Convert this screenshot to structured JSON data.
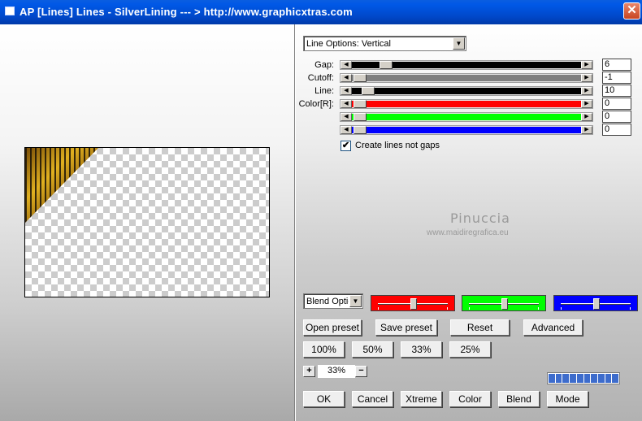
{
  "window": {
    "title": "AP [Lines]  Lines - SilverLining       --- > http://www.graphicxtras.com",
    "close_glyph": "✕"
  },
  "options": {
    "line_options_value": "Line Options: Vertical",
    "blend_options_value": "Blend Optio"
  },
  "sliders": [
    {
      "label": "Gap:",
      "value": "6",
      "color": "#000000",
      "fill_fraction": 0.0
    },
    {
      "label": "Cutoff:",
      "value": "-1",
      "color": "#808080",
      "fill_fraction": 0.0
    },
    {
      "label": "Line:",
      "value": "10",
      "color": "#000000",
      "fill_fraction": 0.0
    },
    {
      "label": "Color[R]:",
      "value": "0",
      "color": "#ff0000",
      "fill_fraction": 0.0
    },
    {
      "label": "",
      "value": "0",
      "color": "#00ff00",
      "fill_fraction": 0.0
    },
    {
      "label": "",
      "value": "0",
      "color": "#0000ff",
      "fill_fraction": 0.0
    }
  ],
  "checkbox": {
    "label": "Create lines not gaps",
    "checked_glyph": "✔",
    "checked": true
  },
  "watermark": {
    "name": "Pinuccia",
    "site": "www.maidiregrafica.eu"
  },
  "blend_colors": [
    {
      "color": "#ff0000",
      "level": 0.5
    },
    {
      "color": "#00ff00",
      "level": 0.5
    },
    {
      "color": "#0000ff",
      "level": 0.5
    }
  ],
  "buttons": {
    "open_preset": "Open preset",
    "save_preset": "Save preset",
    "reset": "Reset",
    "advanced": "Advanced",
    "zoom_100": "100%",
    "zoom_50": "50%",
    "zoom_33": "33%",
    "zoom_25": "25%",
    "ok": "OK",
    "cancel": "Cancel",
    "xtreme": "Xtreme",
    "color": "Color",
    "blend": "Blend",
    "mode": "Mode"
  },
  "zoom": {
    "plus": "+",
    "minus": "−",
    "value": "33%"
  },
  "progress": {
    "segments": 10
  },
  "accent": {
    "titlebar": "#0054e3",
    "progress": "#3d6ccc"
  }
}
